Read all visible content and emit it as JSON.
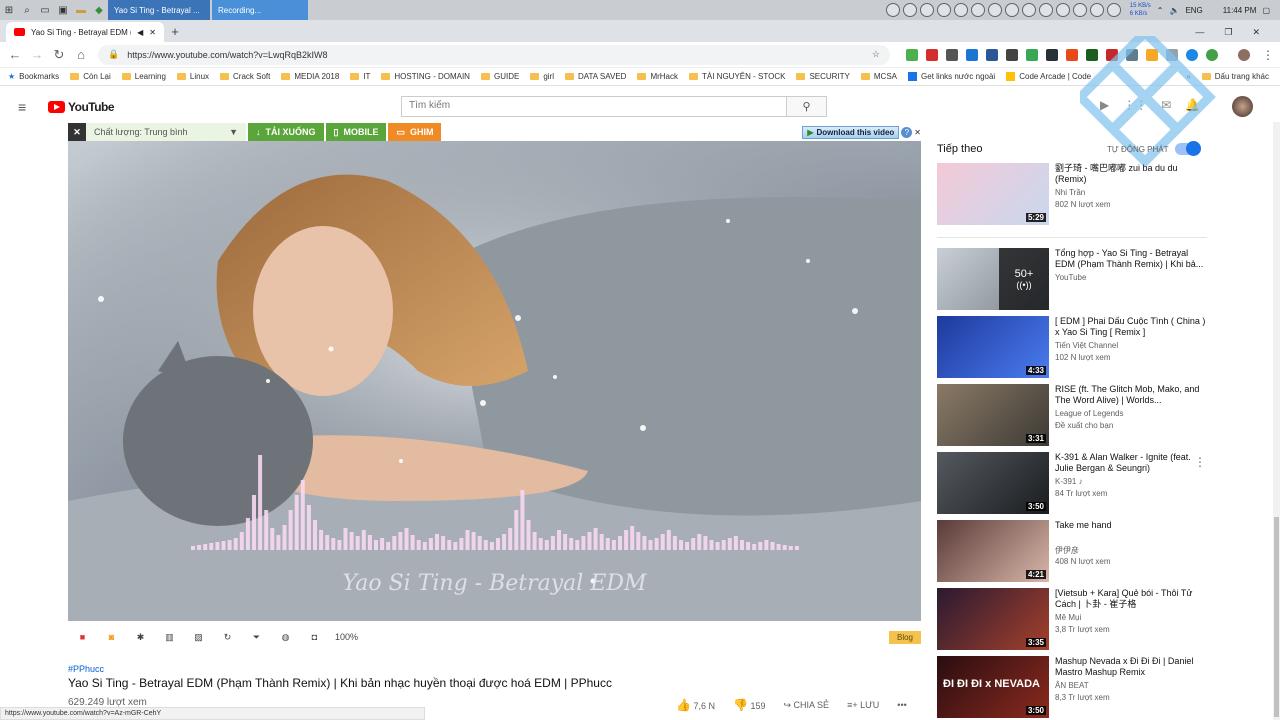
{
  "taskbar": {
    "tasks": [
      {
        "label": "Yao Si Ting - Betrayal ...",
        "color": "#3c74b8"
      },
      {
        "label": "Recording...",
        "color": "#4a90d9"
      }
    ],
    "net_up": "15 KB/s",
    "net_down": "6 KB/s",
    "lang": "ENG",
    "time": "11:44 PM"
  },
  "browser": {
    "tab_title": "Yao Si Ting - Betrayal EDM (",
    "url": "https://www.youtube.com/watch?v=LwqRqB2kIW8",
    "bookmarks": [
      "Bookmarks",
      "Còn Lại",
      "Learning",
      "Linux",
      "Crack Soft",
      "MEDIA 2018",
      "IT",
      "HOSTING - DOMAIN",
      "GUIDE",
      "girl",
      "DATA SAVED",
      "MrHack",
      "TÀI NGUYÊN - STOCK",
      "SECURITY",
      "MCSA",
      "Get links nước ngoài",
      "Code Arcade | Code"
    ],
    "bookmarks_more": "»",
    "bookmarks_other": "Dấu trang khác",
    "status_url": "https://www.youtube.com/watch?v=Az-mGR-CehY"
  },
  "youtube": {
    "logo": "YouTube",
    "search_placeholder": "Tìm kiếm"
  },
  "downloader": {
    "quality": "Chất lượng: Trung bình",
    "download": "TẢI XUỐNG",
    "mobile": "MOBILE",
    "pin": "GHIM",
    "download_video": "Download this video",
    "help": "?",
    "close": "✕"
  },
  "video": {
    "overlay_title": "Yao Si Ting - Betrayal EDM",
    "zoom": "100%",
    "blog": "Blog",
    "hashtag": "#PPhucc",
    "title": "Yao Si Ting - Betrayal EDM (Phạm Thành Remix) | Khi bản nhạc huyền thoại được hoá EDM | PPhucc",
    "views": "629.249 lượt xem",
    "likes": "7,6 N",
    "dislikes": "159",
    "share": "CHIA SẺ",
    "save": "LƯU",
    "more": "•••"
  },
  "sidebar": {
    "up_next": "Tiếp theo",
    "autoplay": "TỰ ĐỘNG PHÁT",
    "items": [
      {
        "title": "劉子琦 - 嘴巴嘟嘟 zui ba du du (Remix)",
        "channel": "Nhi Trần",
        "views": "802 N lượt xem",
        "duration": "5:29",
        "color1": "#f3c9d6",
        "color2": "#c9d8ef"
      },
      {
        "title": "Tổng hợp - Yao Si Ting - Betrayal EDM (Phạm Thành Remix) | Khi bả...",
        "channel": "YouTube",
        "views": "",
        "duration": "",
        "mix_count": "50+",
        "color1": "#c9cfd5",
        "color2": "#7c848d"
      },
      {
        "title": "[ EDM ] Phai Dấu Cuộc Tình ( China ) x Yao Si Ting [ Remix ]",
        "channel": "Tiến Việt Channel",
        "views": "102 N lượt xem",
        "duration": "4:33",
        "color1": "#1e3a9c",
        "color2": "#4a7cf0"
      },
      {
        "title": "RISE (ft. The Glitch Mob, Mako, and The Word Alive) | Worlds...",
        "channel": "League of Legends",
        "views": "Đề xuất cho bạn",
        "duration": "3:31",
        "color1": "#8a7a66",
        "color2": "#3d3a35"
      },
      {
        "title": "K-391 & Alan Walker - Ignite (feat. Julie Bergan & Seungri)",
        "channel": "K-391 ♪",
        "views": "84 Tr lượt xem",
        "duration": "3:50",
        "color1": "#555a60",
        "color2": "#1a1c1f"
      },
      {
        "title": "Take me hand",
        "channel": "伊伊彦",
        "views": "408 N lượt xem",
        "duration": "4:21",
        "color1": "#5a3a38",
        "color2": "#d9b7a9"
      },
      {
        "title": "[Vietsub + Kara] Quẻ bói - Thôi Tử Cách | 卜卦 - 崔子格",
        "channel": "Mê Mụi",
        "views": "3,8 Tr lượt xem",
        "duration": "3:35",
        "color1": "#2a1a30",
        "color2": "#a5402c"
      },
      {
        "title": "Mashup Nevada x Đi Đi Đi | Daniel Mastro Mashup Remix",
        "channel": "ÂN BEAT",
        "views": "8,3 Tr lượt xem",
        "duration": "3:50",
        "thumb_text": "ĐI ĐI ĐI x NEVADA",
        "color1": "#2a0d10",
        "color2": "#8b2a1e"
      }
    ]
  }
}
